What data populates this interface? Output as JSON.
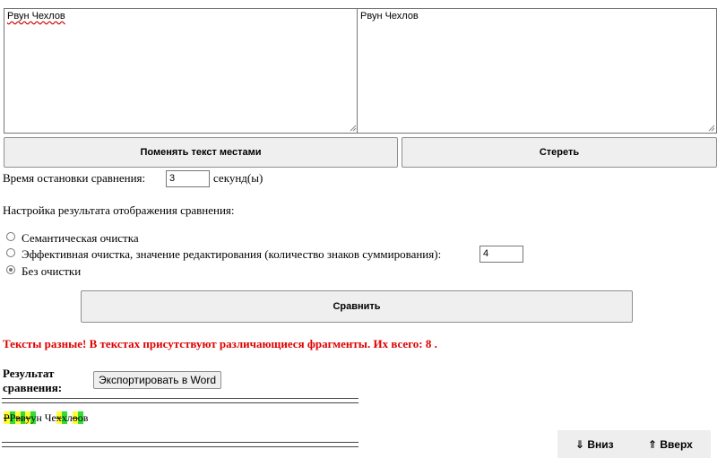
{
  "left_text": "Рвун  Чехлов",
  "right_text": "Рвун  Чехлов",
  "buttons": {
    "swap": "Поменять текст местами",
    "clear": "Стереть",
    "compare": "Сравнить",
    "export": "Экспортировать в Word"
  },
  "timeout": {
    "label": "Время остановки сравнения:",
    "value": "3",
    "unit": "секунд(ы)"
  },
  "settings_title": "Настройка результата отображения сравнения:",
  "options": {
    "semantic": "Семантическая очистка",
    "efficient": "Эффективная очистка, значение редактирования (количество знаков суммирования):",
    "efficient_value": "4",
    "none": "Без очистки",
    "selected": "none"
  },
  "result_message": "Тексты разные! В текстах присутствуют различающиеся фрагменты. Их всего: 8 .",
  "result_label_line1": "Результат",
  "result_label_line2": "сравнения:",
  "separator": "==================================================",
  "diff": [
    {
      "t": "Р",
      "op": "del"
    },
    {
      "t": "Р",
      "op": "ins"
    },
    {
      "t": "в",
      "op": "del"
    },
    {
      "t": "в",
      "op": "ins"
    },
    {
      "t": "у",
      "op": "del"
    },
    {
      "t": "у",
      "op": "ins"
    },
    {
      "t": "н  Че",
      "op": "eq"
    },
    {
      "t": "х",
      "op": "del"
    },
    {
      "t": "х",
      "op": "ins"
    },
    {
      "t": "л",
      "op": "eq"
    },
    {
      "t": "о",
      "op": "del"
    },
    {
      "t": "о",
      "op": "ins"
    },
    {
      "t": "в",
      "op": "eq"
    }
  ],
  "nav": {
    "down": "⇓ Вниз",
    "up": "⇑ Вверх"
  }
}
